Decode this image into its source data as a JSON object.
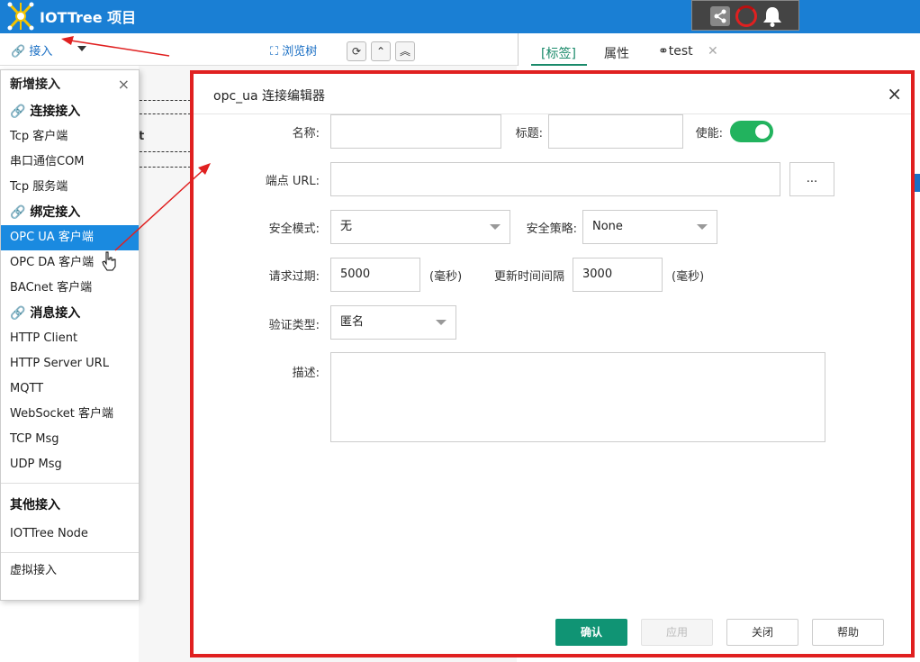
{
  "app": {
    "title": "IOTTree 项目"
  },
  "toolbar": {
    "connect_label": "接入",
    "browse_label": "浏览树",
    "refresh_glyph": "⟳",
    "up_glyph": "⌃",
    "top_glyph": "︽"
  },
  "right_tabs": {
    "tag_label": "[标签]",
    "props_label": "属性",
    "test_label": "test",
    "close_glyph": "✕"
  },
  "bg": {
    "fragment_text": "t"
  },
  "menu": {
    "title": "新增接入",
    "close": "×",
    "group_connect": "连接接入",
    "items_connect": [
      "Tcp 客户端",
      "串口通信COM",
      "Tcp 服务端"
    ],
    "group_bind": "绑定接入",
    "items_bind": [
      "OPC UA 客户端",
      "OPC DA 客户端",
      "BACnet 客户端"
    ],
    "selected_item": "OPC UA 客户端",
    "group_msg": "消息接入",
    "items_msg": [
      "HTTP Client",
      "HTTP Server URL",
      "MQTT",
      "WebSocket 客户端",
      "TCP Msg",
      "UDP Msg"
    ],
    "group_other": "其他接入",
    "items_other": [
      "IOTTree Node"
    ],
    "virtual": "虚拟接入"
  },
  "dialog": {
    "title": "opc_ua 连接编辑器",
    "close": "×",
    "name_label": "名称:",
    "name_value": "",
    "title_label": "标题:",
    "title_value": "",
    "enable_label": "使能:",
    "enabled": true,
    "endpoint_label": "端点 URL:",
    "endpoint_value": "",
    "browse_btn": "...",
    "security_mode_label": "安全模式:",
    "security_mode_value": "无",
    "security_policy_label": "安全策略:",
    "security_policy_value": "None",
    "request_timeout_label": "请求过期:",
    "request_timeout_value": "5000",
    "ms_unit": "(毫秒)",
    "update_interval_label": "更新时间间隔",
    "update_interval_value": "3000",
    "auth_type_label": "验证类型:",
    "auth_type_value": "匿名",
    "desc_label": "描述:",
    "desc_value": "",
    "buttons": {
      "ok": "确认",
      "apply": "应用",
      "close": "关闭",
      "help": "帮助"
    }
  },
  "colors": {
    "topbar": "#1a7fd4",
    "accent": "#109474",
    "selected": "#1a8ae0",
    "highlight_border": "#e02020",
    "toggle_on": "#22b35e"
  }
}
